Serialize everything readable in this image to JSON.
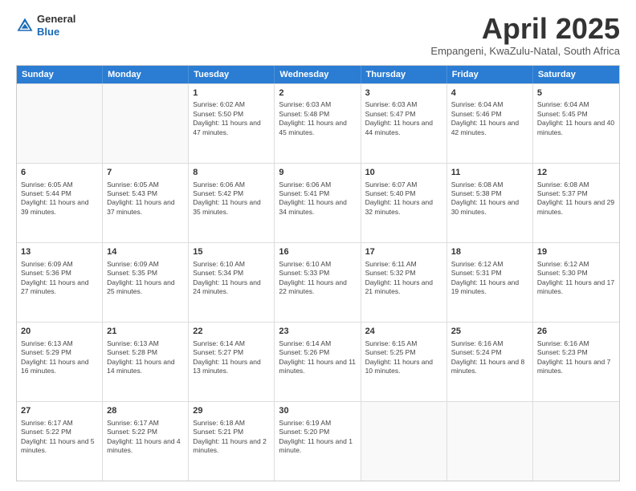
{
  "header": {
    "logo_line1": "General",
    "logo_line2": "Blue",
    "title": "April 2025",
    "location": "Empangeni, KwaZulu-Natal, South Africa"
  },
  "weekdays": [
    "Sunday",
    "Monday",
    "Tuesday",
    "Wednesday",
    "Thursday",
    "Friday",
    "Saturday"
  ],
  "weeks": [
    [
      {
        "day": "",
        "sunrise": "",
        "sunset": "",
        "daylight": "",
        "empty": true
      },
      {
        "day": "",
        "sunrise": "",
        "sunset": "",
        "daylight": "",
        "empty": true
      },
      {
        "day": "1",
        "sunrise": "Sunrise: 6:02 AM",
        "sunset": "Sunset: 5:50 PM",
        "daylight": "Daylight: 11 hours and 47 minutes.",
        "empty": false
      },
      {
        "day": "2",
        "sunrise": "Sunrise: 6:03 AM",
        "sunset": "Sunset: 5:48 PM",
        "daylight": "Daylight: 11 hours and 45 minutes.",
        "empty": false
      },
      {
        "day": "3",
        "sunrise": "Sunrise: 6:03 AM",
        "sunset": "Sunset: 5:47 PM",
        "daylight": "Daylight: 11 hours and 44 minutes.",
        "empty": false
      },
      {
        "day": "4",
        "sunrise": "Sunrise: 6:04 AM",
        "sunset": "Sunset: 5:46 PM",
        "daylight": "Daylight: 11 hours and 42 minutes.",
        "empty": false
      },
      {
        "day": "5",
        "sunrise": "Sunrise: 6:04 AM",
        "sunset": "Sunset: 5:45 PM",
        "daylight": "Daylight: 11 hours and 40 minutes.",
        "empty": false
      }
    ],
    [
      {
        "day": "6",
        "sunrise": "Sunrise: 6:05 AM",
        "sunset": "Sunset: 5:44 PM",
        "daylight": "Daylight: 11 hours and 39 minutes.",
        "empty": false
      },
      {
        "day": "7",
        "sunrise": "Sunrise: 6:05 AM",
        "sunset": "Sunset: 5:43 PM",
        "daylight": "Daylight: 11 hours and 37 minutes.",
        "empty": false
      },
      {
        "day": "8",
        "sunrise": "Sunrise: 6:06 AM",
        "sunset": "Sunset: 5:42 PM",
        "daylight": "Daylight: 11 hours and 35 minutes.",
        "empty": false
      },
      {
        "day": "9",
        "sunrise": "Sunrise: 6:06 AM",
        "sunset": "Sunset: 5:41 PM",
        "daylight": "Daylight: 11 hours and 34 minutes.",
        "empty": false
      },
      {
        "day": "10",
        "sunrise": "Sunrise: 6:07 AM",
        "sunset": "Sunset: 5:40 PM",
        "daylight": "Daylight: 11 hours and 32 minutes.",
        "empty": false
      },
      {
        "day": "11",
        "sunrise": "Sunrise: 6:08 AM",
        "sunset": "Sunset: 5:38 PM",
        "daylight": "Daylight: 11 hours and 30 minutes.",
        "empty": false
      },
      {
        "day": "12",
        "sunrise": "Sunrise: 6:08 AM",
        "sunset": "Sunset: 5:37 PM",
        "daylight": "Daylight: 11 hours and 29 minutes.",
        "empty": false
      }
    ],
    [
      {
        "day": "13",
        "sunrise": "Sunrise: 6:09 AM",
        "sunset": "Sunset: 5:36 PM",
        "daylight": "Daylight: 11 hours and 27 minutes.",
        "empty": false
      },
      {
        "day": "14",
        "sunrise": "Sunrise: 6:09 AM",
        "sunset": "Sunset: 5:35 PM",
        "daylight": "Daylight: 11 hours and 25 minutes.",
        "empty": false
      },
      {
        "day": "15",
        "sunrise": "Sunrise: 6:10 AM",
        "sunset": "Sunset: 5:34 PM",
        "daylight": "Daylight: 11 hours and 24 minutes.",
        "empty": false
      },
      {
        "day": "16",
        "sunrise": "Sunrise: 6:10 AM",
        "sunset": "Sunset: 5:33 PM",
        "daylight": "Daylight: 11 hours and 22 minutes.",
        "empty": false
      },
      {
        "day": "17",
        "sunrise": "Sunrise: 6:11 AM",
        "sunset": "Sunset: 5:32 PM",
        "daylight": "Daylight: 11 hours and 21 minutes.",
        "empty": false
      },
      {
        "day": "18",
        "sunrise": "Sunrise: 6:12 AM",
        "sunset": "Sunset: 5:31 PM",
        "daylight": "Daylight: 11 hours and 19 minutes.",
        "empty": false
      },
      {
        "day": "19",
        "sunrise": "Sunrise: 6:12 AM",
        "sunset": "Sunset: 5:30 PM",
        "daylight": "Daylight: 11 hours and 17 minutes.",
        "empty": false
      }
    ],
    [
      {
        "day": "20",
        "sunrise": "Sunrise: 6:13 AM",
        "sunset": "Sunset: 5:29 PM",
        "daylight": "Daylight: 11 hours and 16 minutes.",
        "empty": false
      },
      {
        "day": "21",
        "sunrise": "Sunrise: 6:13 AM",
        "sunset": "Sunset: 5:28 PM",
        "daylight": "Daylight: 11 hours and 14 minutes.",
        "empty": false
      },
      {
        "day": "22",
        "sunrise": "Sunrise: 6:14 AM",
        "sunset": "Sunset: 5:27 PM",
        "daylight": "Daylight: 11 hours and 13 minutes.",
        "empty": false
      },
      {
        "day": "23",
        "sunrise": "Sunrise: 6:14 AM",
        "sunset": "Sunset: 5:26 PM",
        "daylight": "Daylight: 11 hours and 11 minutes.",
        "empty": false
      },
      {
        "day": "24",
        "sunrise": "Sunrise: 6:15 AM",
        "sunset": "Sunset: 5:25 PM",
        "daylight": "Daylight: 11 hours and 10 minutes.",
        "empty": false
      },
      {
        "day": "25",
        "sunrise": "Sunrise: 6:16 AM",
        "sunset": "Sunset: 5:24 PM",
        "daylight": "Daylight: 11 hours and 8 minutes.",
        "empty": false
      },
      {
        "day": "26",
        "sunrise": "Sunrise: 6:16 AM",
        "sunset": "Sunset: 5:23 PM",
        "daylight": "Daylight: 11 hours and 7 minutes.",
        "empty": false
      }
    ],
    [
      {
        "day": "27",
        "sunrise": "Sunrise: 6:17 AM",
        "sunset": "Sunset: 5:22 PM",
        "daylight": "Daylight: 11 hours and 5 minutes.",
        "empty": false
      },
      {
        "day": "28",
        "sunrise": "Sunrise: 6:17 AM",
        "sunset": "Sunset: 5:22 PM",
        "daylight": "Daylight: 11 hours and 4 minutes.",
        "empty": false
      },
      {
        "day": "29",
        "sunrise": "Sunrise: 6:18 AM",
        "sunset": "Sunset: 5:21 PM",
        "daylight": "Daylight: 11 hours and 2 minutes.",
        "empty": false
      },
      {
        "day": "30",
        "sunrise": "Sunrise: 6:19 AM",
        "sunset": "Sunset: 5:20 PM",
        "daylight": "Daylight: 11 hours and 1 minute.",
        "empty": false
      },
      {
        "day": "",
        "sunrise": "",
        "sunset": "",
        "daylight": "",
        "empty": true
      },
      {
        "day": "",
        "sunrise": "",
        "sunset": "",
        "daylight": "",
        "empty": true
      },
      {
        "day": "",
        "sunrise": "",
        "sunset": "",
        "daylight": "",
        "empty": true
      }
    ]
  ]
}
